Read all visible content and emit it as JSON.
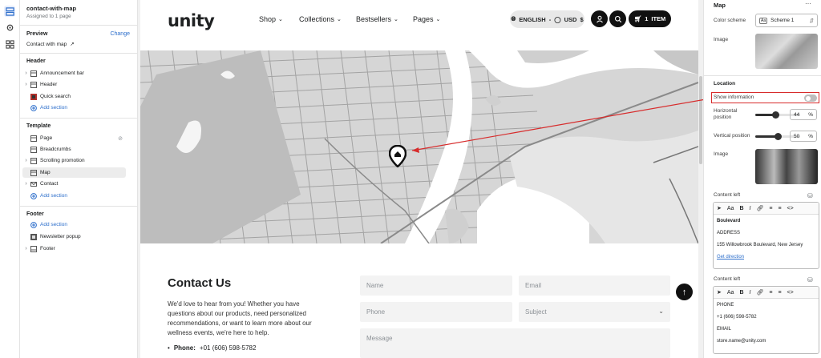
{
  "sidebar": {
    "template_name": "contact-with-map",
    "assigned": "Assigned to 1 page",
    "preview_label": "Preview",
    "change_label": "Change",
    "preview_page": "Contact with map",
    "header_group": "Header",
    "header_items": [
      "Announcement bar",
      "Header",
      "Quick search"
    ],
    "add_section": "Add section",
    "template_group": "Template",
    "template_items": [
      "Page",
      "Breadcrumbs",
      "Scrolling promotion",
      "Map",
      "Contact"
    ],
    "footer_group": "Footer",
    "footer_items": [
      "Newsletter popup",
      "Footer"
    ]
  },
  "store": {
    "logo": "unity",
    "nav": [
      "Shop",
      "Collections",
      "Bestsellers",
      "Pages"
    ],
    "language": "ENGLISH",
    "currency": "USD",
    "currency_symbol": "$",
    "cart_count": "1",
    "cart_label": "ITEM"
  },
  "contact": {
    "title": "Contact Us",
    "text": "We'd love to hear from you! Whether you have questions about our products, need personalized recommendations, or want to learn more about our wellness events, we're here to help.",
    "phone_label": "Phone:",
    "phone_value": "+01 (606) 598-5782",
    "name_placeholder": "Name",
    "email_placeholder": "Email",
    "phone_placeholder": "Phone",
    "subject_placeholder": "Subject",
    "message_placeholder": "Message"
  },
  "panel": {
    "title": "Map",
    "color_scheme_label": "Color scheme",
    "color_scheme_value": "Scheme 1",
    "image_label": "Image",
    "location_heading": "Location",
    "show_information_label": "Show information",
    "show_information": false,
    "horizontal_label": "Horizontal position",
    "horizontal_value": "44",
    "vertical_label": "Vertical position",
    "vertical_value": "50",
    "percent": "%",
    "image2_label": "Image",
    "content_left_label": "Content left",
    "content_left_1": [
      "Boulevard",
      "ADDRESS",
      "155 Willowbrook Boulevard, New Jersey",
      "Get direction"
    ],
    "content_left_2": [
      "PHONE",
      "+1 (606) 598-5782",
      "EMAIL",
      "store.name@unity.com"
    ],
    "toolbar": [
      "Aa",
      "B",
      "I"
    ]
  },
  "colors": {
    "accent": "#2c6ecb",
    "highlight": "#d72c2c",
    "dark": "#111111"
  }
}
